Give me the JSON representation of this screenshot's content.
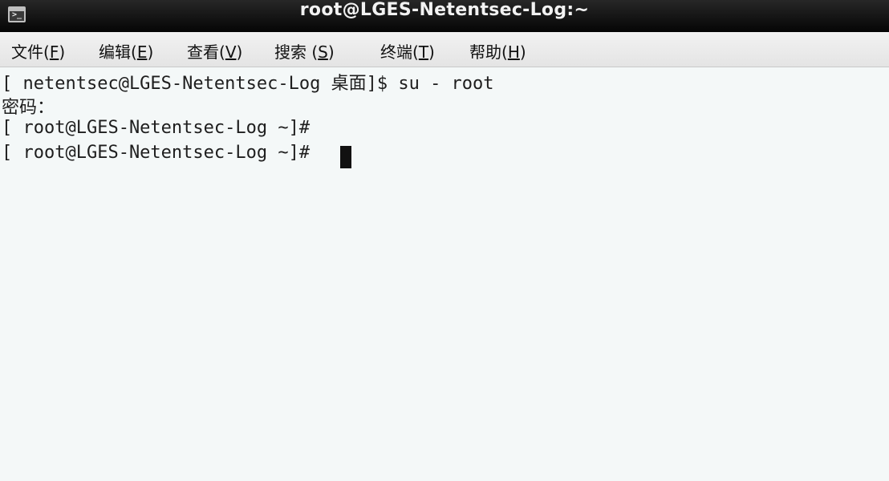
{
  "window": {
    "title": "root@LGES-Netentsec-Log:~",
    "icon": "terminal-icon"
  },
  "menubar": {
    "items": [
      {
        "label": "文件",
        "mnemonic": "F"
      },
      {
        "label": "编辑",
        "mnemonic": "E"
      },
      {
        "label": "查看",
        "mnemonic": "V"
      },
      {
        "label": "搜索",
        "mnemonic": "S"
      },
      {
        "label": "终端",
        "mnemonic": "T"
      },
      {
        "label": "帮助",
        "mnemonic": "H"
      }
    ]
  },
  "terminal": {
    "lines": [
      "[ netentsec@LGES-Netentsec-Log 桌面]$ su - root",
      "密码：",
      "[ root@LGES-Netentsec-Log ~]#",
      "[ root@LGES-Netentsec-Log ~]# "
    ],
    "cursor": "block"
  },
  "colors": {
    "titlebar": "#0c0c0c",
    "menubar": "#ececec",
    "terminal_bg": "#f4f8f8",
    "terminal_fg": "#1e1e1e"
  }
}
